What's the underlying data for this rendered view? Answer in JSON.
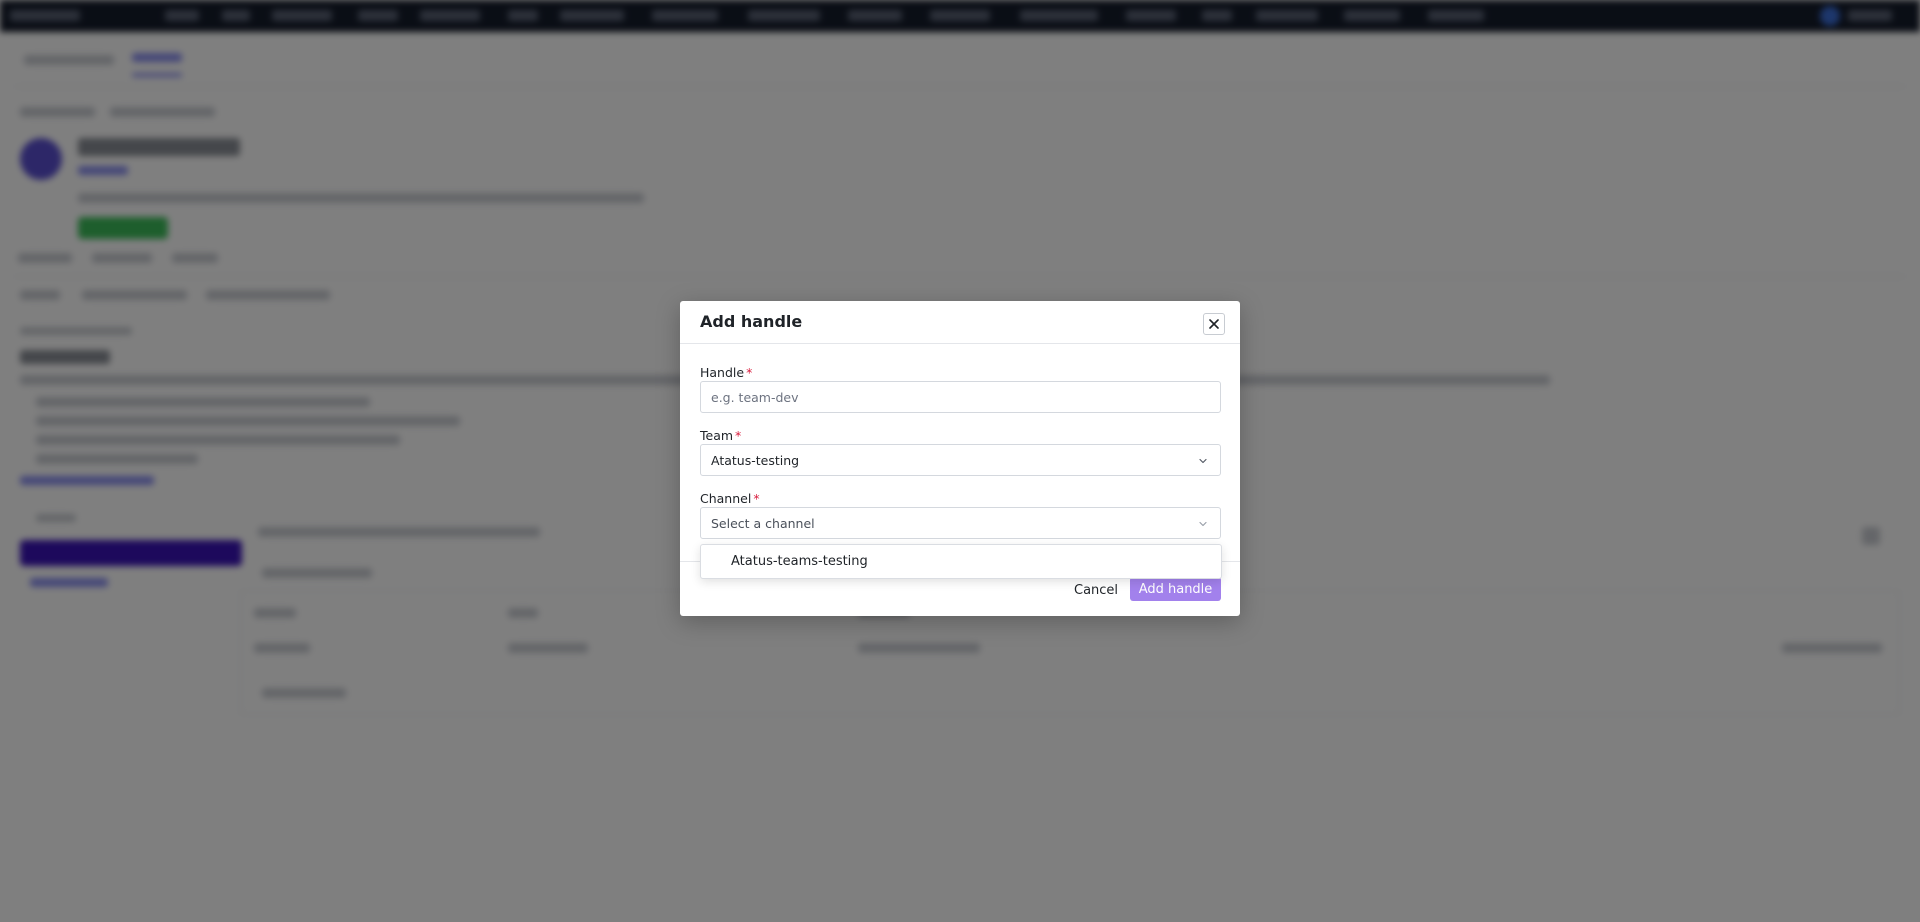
{
  "modal": {
    "title": "Add handle",
    "close_icon": "close-icon",
    "handle": {
      "label": "Handle",
      "required_mark": "*",
      "value": "",
      "placeholder": "e.g. team-dev"
    },
    "team": {
      "label": "Team",
      "required_mark": "*",
      "value": "Atatus-testing"
    },
    "channel": {
      "label": "Channel",
      "required_mark": "*",
      "placeholder": "Select a channel",
      "options": [
        "Atatus-teams-testing"
      ]
    },
    "cancel_label": "Cancel",
    "submit_label": "Add handle"
  },
  "colors": {
    "primary_button": "#a281ec",
    "required": "#d81b3c",
    "overlay": "rgba(0,0,0,0.5)"
  }
}
